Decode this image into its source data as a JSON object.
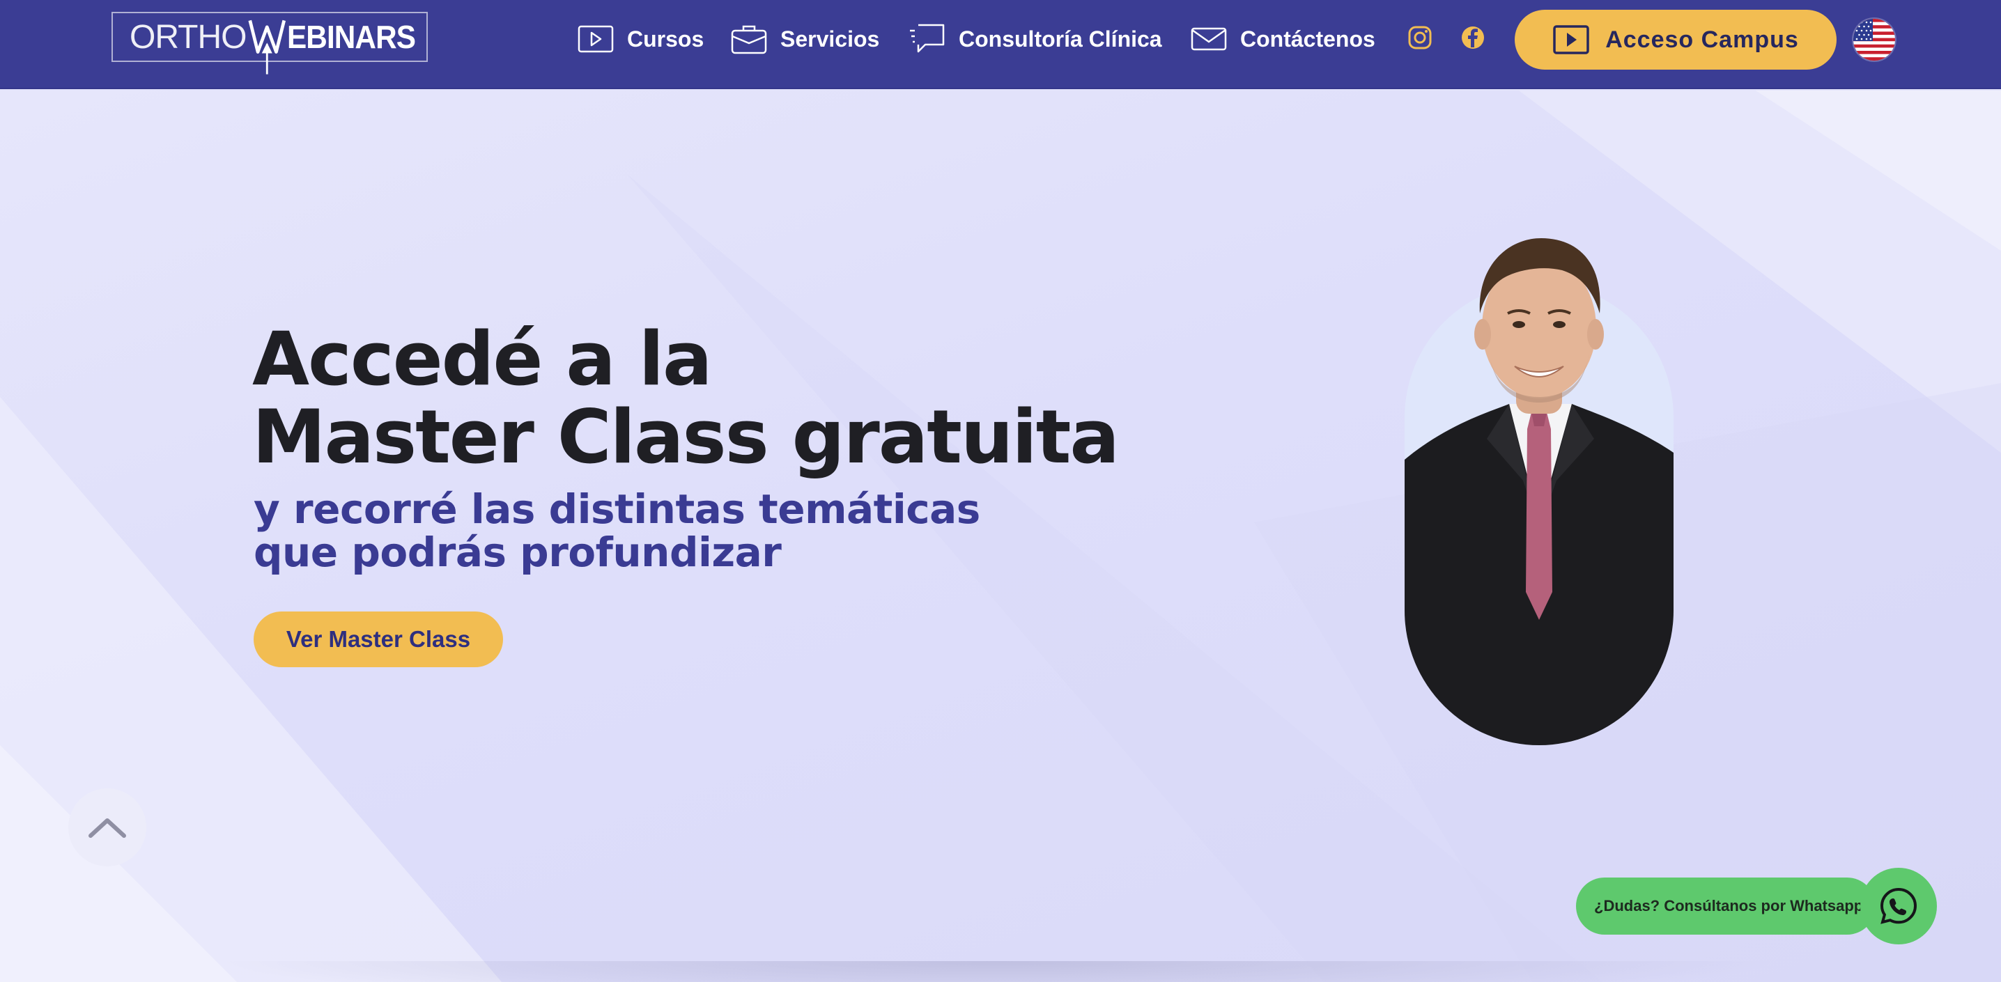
{
  "brand": {
    "logo_text_light": "ORTHO",
    "logo_text_bold": "EBINARS"
  },
  "nav": {
    "items": [
      {
        "label": "Cursos",
        "icon": "play-square-icon"
      },
      {
        "label": "Servicios",
        "icon": "briefcase-icon"
      },
      {
        "label": "Consultoría Clínica",
        "icon": "chat-bubble-icon"
      },
      {
        "label": "Contáctenos",
        "icon": "envelope-icon"
      }
    ],
    "social": [
      "instagram-icon",
      "facebook-icon"
    ],
    "campus_button": "Acceso Campus",
    "language_flag": "us-flag-icon"
  },
  "hero": {
    "headline_line1": "Accedé a la",
    "headline_line2": "Master Class gratuita",
    "sub_line1": "y recorré las distintas temáticas",
    "sub_line2": "que podrás profundizar",
    "cta": "Ver Master Class"
  },
  "whatsapp": {
    "label": "¿Dudas? Consúltanos por Whatsapp"
  },
  "colors": {
    "navbar": "#3b3d94",
    "accent_yellow": "#f2bd52",
    "headline": "#1f1f24",
    "subline": "#3a3b93",
    "hero_bg": "#e2e2fa",
    "whatsapp_green": "#5ec96d"
  }
}
